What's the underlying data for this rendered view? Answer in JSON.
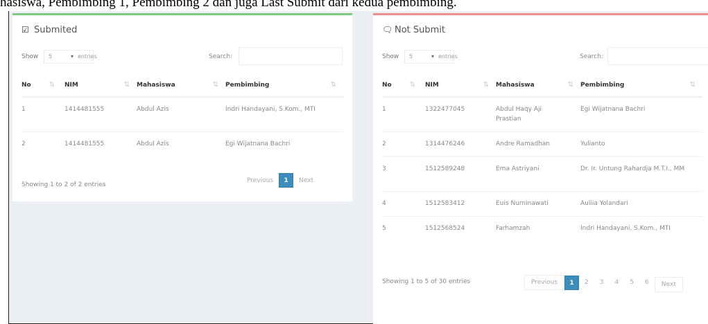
{
  "caption": "hasiswa, Pembimbing 1, Pembimbing 2 dan juga Last Submit dari kedua pembimbing.",
  "submitted": {
    "title": "Submited",
    "icon": "check-square-icon",
    "show_label": "Show",
    "length_value": "5",
    "entries_label": "entries",
    "search_label": "Search:",
    "search_value": "",
    "columns": [
      "No",
      "NIM",
      "Mahasiswa",
      "Pembimbing"
    ],
    "rows": [
      {
        "no": "1",
        "nim": "1414481555",
        "mahasiswa": "Abdul Azis",
        "pembimbing": "Indri Handayani, S.Kom., MTI"
      },
      {
        "no": "2",
        "nim": "1414481555",
        "mahasiswa": "Abdul Azis",
        "pembimbing": "Egi Wijatnana Bachri"
      }
    ],
    "info": "Showing 1 to 2 of 2 entries",
    "pager": {
      "previous": "Previous",
      "current": "1",
      "next": "Next"
    }
  },
  "not_submitted": {
    "title": "Not Submit",
    "icon": "comment-icon",
    "show_label": "Show",
    "length_value": "5",
    "entries_label": "entries",
    "search_label": "Search:",
    "search_value": "",
    "columns": [
      "No",
      "NIM",
      "Mahasiswa",
      "Pembimbing"
    ],
    "rows": [
      {
        "no": "1",
        "nim": "1322477045",
        "mahasiswa": "Abdul Haqy Aji Prastian",
        "pembimbing": "Egi Wijatnana Bachri"
      },
      {
        "no": "2",
        "nim": "1314476246",
        "mahasiswa": "Andre Ramadhan",
        "pembimbing": "Yulianto"
      },
      {
        "no": "3",
        "nim": "1512589248",
        "mahasiswa": "Ema Astriyani",
        "pembimbing": "Dr. Ir. Untung Rahardja M.T.I., MM"
      },
      {
        "no": "4",
        "nim": "1512583412",
        "mahasiswa": "Euis Nurninawati",
        "pembimbing": "Auliia Yolandari"
      },
      {
        "no": "5",
        "nim": "1512568524",
        "mahasiswa": "Farhamzah",
        "pembimbing": "Indri Handayani, S.Kom., MTI"
      }
    ],
    "info": "Showing 1 to 5 of 30 entries",
    "pager": {
      "previous": "Previous",
      "pages": [
        "1",
        "2",
        "3",
        "4",
        "5",
        "6"
      ],
      "next": "Next"
    }
  },
  "colors": {
    "success": "#7fc77f",
    "danger": "#f28b8b",
    "primary": "#3c8dbc",
    "background": "#ecf0f5"
  }
}
